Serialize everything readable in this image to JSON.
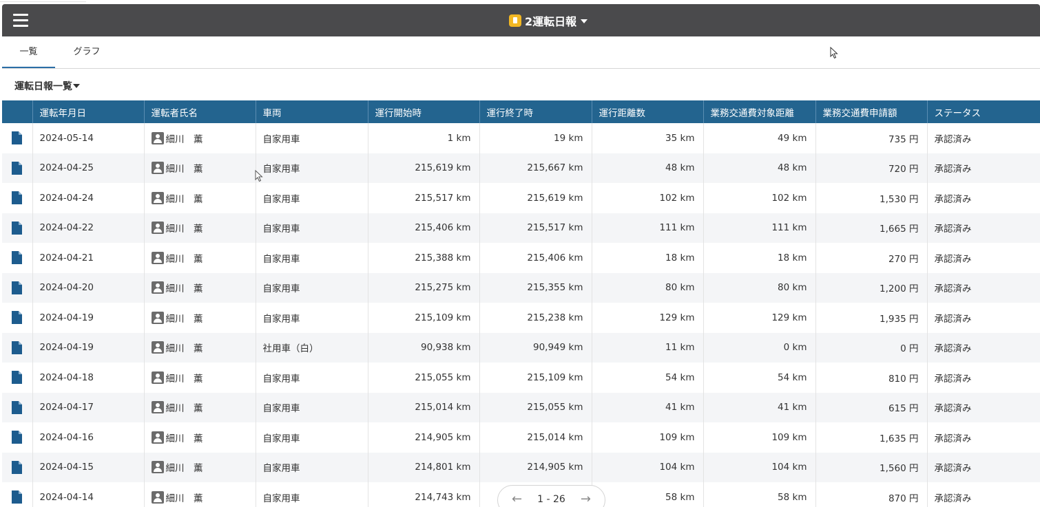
{
  "app": {
    "title": "2運転日報"
  },
  "tabs": [
    {
      "label": "一覧",
      "active": true
    },
    {
      "label": "グラフ",
      "active": false
    }
  ],
  "view": {
    "name": "運転日報一覧"
  },
  "table": {
    "columns": [
      "運転年月日",
      "運転者氏名",
      "車両",
      "運行開始時",
      "運行終了時",
      "運行距離数",
      "業務交通費対象距離",
      "業務交通費申請額",
      "ステータス"
    ],
    "rows": [
      {
        "date": "2024-05-14",
        "driver": "細川　薫",
        "vehicle": "自家用車",
        "start": "1 km",
        "end": "19 km",
        "distance": "35 km",
        "target_distance": "49 km",
        "amount": "735 円",
        "status": "承認済み"
      },
      {
        "date": "2024-04-25",
        "driver": "細川　薫",
        "vehicle": "自家用車",
        "start": "215,619 km",
        "end": "215,667 km",
        "distance": "48 km",
        "target_distance": "48 km",
        "amount": "720 円",
        "status": "承認済み"
      },
      {
        "date": "2024-04-24",
        "driver": "細川　薫",
        "vehicle": "自家用車",
        "start": "215,517 km",
        "end": "215,619 km",
        "distance": "102 km",
        "target_distance": "102 km",
        "amount": "1,530 円",
        "status": "承認済み"
      },
      {
        "date": "2024-04-22",
        "driver": "細川　薫",
        "vehicle": "自家用車",
        "start": "215,406 km",
        "end": "215,517 km",
        "distance": "111 km",
        "target_distance": "111 km",
        "amount": "1,665 円",
        "status": "承認済み"
      },
      {
        "date": "2024-04-21",
        "driver": "細川　薫",
        "vehicle": "自家用車",
        "start": "215,388 km",
        "end": "215,406 km",
        "distance": "18 km",
        "target_distance": "18 km",
        "amount": "270 円",
        "status": "承認済み"
      },
      {
        "date": "2024-04-20",
        "driver": "細川　薫",
        "vehicle": "自家用車",
        "start": "215,275 km",
        "end": "215,355 km",
        "distance": "80 km",
        "target_distance": "80 km",
        "amount": "1,200 円",
        "status": "承認済み"
      },
      {
        "date": "2024-04-19",
        "driver": "細川　薫",
        "vehicle": "自家用車",
        "start": "215,109 km",
        "end": "215,238 km",
        "distance": "129 km",
        "target_distance": "129 km",
        "amount": "1,935 円",
        "status": "承認済み"
      },
      {
        "date": "2024-04-19",
        "driver": "細川　薫",
        "vehicle": "社用車（白）",
        "start": "90,938 km",
        "end": "90,949 km",
        "distance": "11 km",
        "target_distance": "0 km",
        "amount": "0 円",
        "status": "承認済み"
      },
      {
        "date": "2024-04-18",
        "driver": "細川　薫",
        "vehicle": "自家用車",
        "start": "215,055 km",
        "end": "215,109 km",
        "distance": "54 km",
        "target_distance": "54 km",
        "amount": "810 円",
        "status": "承認済み"
      },
      {
        "date": "2024-04-17",
        "driver": "細川　薫",
        "vehicle": "自家用車",
        "start": "215,014 km",
        "end": "215,055 km",
        "distance": "41 km",
        "target_distance": "41 km",
        "amount": "615 円",
        "status": "承認済み"
      },
      {
        "date": "2024-04-16",
        "driver": "細川　薫",
        "vehicle": "自家用車",
        "start": "214,905 km",
        "end": "215,014 km",
        "distance": "109 km",
        "target_distance": "109 km",
        "amount": "1,635 円",
        "status": "承認済み"
      },
      {
        "date": "2024-04-15",
        "driver": "細川　薫",
        "vehicle": "自家用車",
        "start": "214,801 km",
        "end": "214,905 km",
        "distance": "104 km",
        "target_distance": "104 km",
        "amount": "1,560 円",
        "status": "承認済み"
      },
      {
        "date": "2024-04-14",
        "driver": "細川　薫",
        "vehicle": "自家用車",
        "start": "214,743 km",
        "end": "",
        "distance": "58 km",
        "target_distance": "58 km",
        "amount": "870 円",
        "status": "承認済み"
      }
    ]
  },
  "pager": {
    "range": "1 - 26",
    "prev_icon": "arrow-left-icon",
    "next_icon": "arrow-right-icon"
  },
  "colors": {
    "header_bg": "#4a4a4c",
    "table_header_bg": "#23648f",
    "accent": "#2a6ea6",
    "app_badge": "#f2b722"
  }
}
